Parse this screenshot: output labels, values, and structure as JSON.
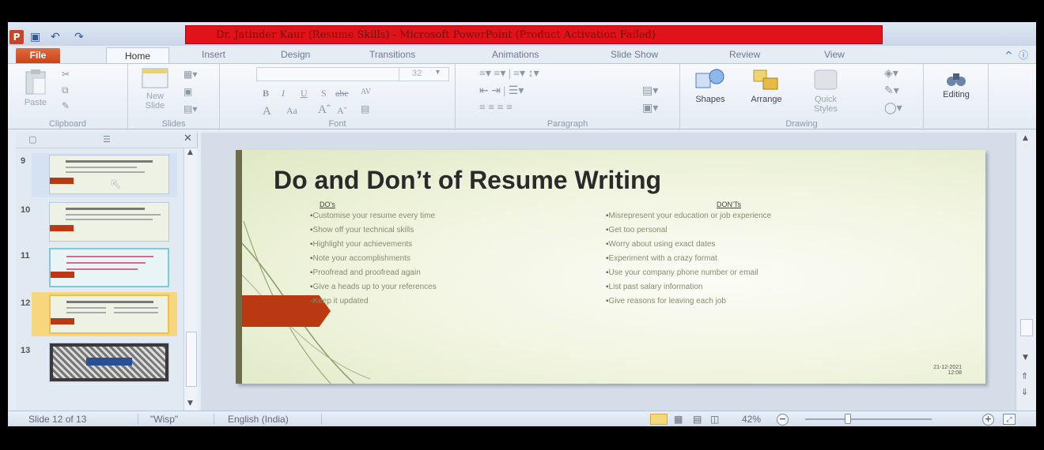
{
  "window": {
    "title": "Dr. Jatinder Kaur (Resume Skills) - Microsoft PowerPoint (Product Activation Failed)",
    "app_icon": "P",
    "qat_icons": [
      "save-icon",
      "undo-icon",
      "redo-icon"
    ]
  },
  "tabs": {
    "file": "File",
    "items": [
      "Home",
      "Insert",
      "Design",
      "Transitions",
      "Animations",
      "Slide Show",
      "Review",
      "View"
    ],
    "active": "Home"
  },
  "ribbon": {
    "clipboard": {
      "paste": "Paste",
      "label": "Clipboard"
    },
    "slides": {
      "new_slide_line1": "New",
      "new_slide_line2": "Slide",
      "label": "Slides"
    },
    "font": {
      "size": "32",
      "label": "Font",
      "bold": "B",
      "italic": "I",
      "underline": "U",
      "strike": "S",
      "shadow": "abe",
      "spacing": "AV",
      "grow": "A",
      "change_case": "Aa"
    },
    "paragraph": {
      "label": "Paragraph"
    },
    "drawing": {
      "shapes": "Shapes",
      "arrange": "Arrange",
      "quick_styles_line1": "Quick",
      "quick_styles_line2": "Styles",
      "label": "Drawing"
    },
    "editing": {
      "label": "Editing"
    }
  },
  "slides_panel": {
    "thumbnails": [
      {
        "number": "9",
        "state": "hover"
      },
      {
        "number": "10",
        "state": "normal"
      },
      {
        "number": "11",
        "state": "normal"
      },
      {
        "number": "12",
        "state": "selected"
      },
      {
        "number": "13",
        "state": "normal"
      }
    ]
  },
  "slide": {
    "title": "Do and Don’t of Resume Writing",
    "dos_heading": "DO’s",
    "donts_heading": "DON’Ts",
    "dos": [
      "Customise your resume every time",
      "Show off your technical skills",
      "Highlight your achievements",
      "Note your accomplishments",
      "Proofread and proofread again",
      "Give a heads up to your references",
      "Keep it updated"
    ],
    "donts": [
      "Misrepresent your education or job experience",
      "Get too personal",
      "Worry about using exact dates",
      "Experiment with a crazy format",
      "Use your company phone number or email",
      "List past salary information",
      "Give reasons for leaving each job"
    ],
    "date": "21-12-2021",
    "time": "12:08"
  },
  "status": {
    "slide_info": "Slide 12 of 13",
    "theme": "\"Wisp\"",
    "language": "English (India)",
    "zoom": "42%"
  },
  "colors": {
    "accent_red": "#e0131a",
    "file_tab": "#c94419",
    "selected_thumb": "#f7d77e",
    "slide_arrow": "#b93a12"
  }
}
